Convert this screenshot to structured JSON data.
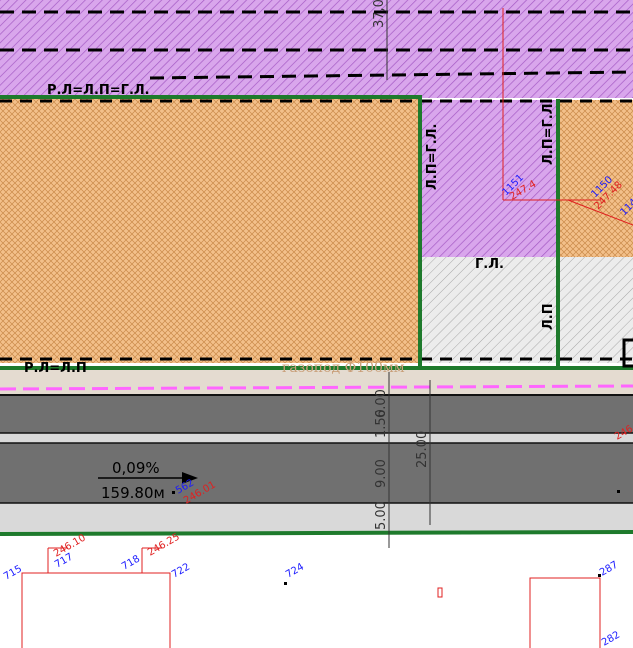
{
  "colors": {
    "purple_zone": "#d9a6ec",
    "orange_zone": "#f3c08a",
    "road_dark": "#707070",
    "road_light": "#d9d9d9",
    "green_line": "#1e7a2c",
    "magenta_dash": "#ff66ff",
    "gas_text": "#c9a07a"
  },
  "labels": {
    "zone_top": "Р.Л=Л.П=Г.Л.",
    "zone_bottom": "Р.Л=Л.П",
    "vertical_1": "Л.П=Г.Л.",
    "vertical_2": "Л.П=Г.Л.",
    "vertical_3": "Л.П",
    "gl": "Г.Л.",
    "gas": "газопод Ф100мм",
    "slope_percent": "0,09%",
    "slope_length": "159.80м"
  },
  "dimensions": {
    "top_vertical": "37,0",
    "d1": "6.00",
    "d2": "1.50",
    "d3": "9.00",
    "d4": "25.00",
    "d5": "5.00"
  },
  "points": [
    {
      "id": "715"
    },
    {
      "id": "717"
    },
    {
      "id": "718"
    },
    {
      "id": "722"
    },
    {
      "id": "724"
    },
    {
      "id": "287"
    },
    {
      "id": "282"
    },
    {
      "id": "562"
    },
    {
      "id": "1151"
    },
    {
      "id": "1150"
    },
    {
      "id": "114"
    }
  ],
  "elevations": {
    "e1": "246.10",
    "e2": "246.25",
    "e3": "246.01",
    "e4": "247.48",
    "e5": "247.4",
    "e6": "246"
  }
}
